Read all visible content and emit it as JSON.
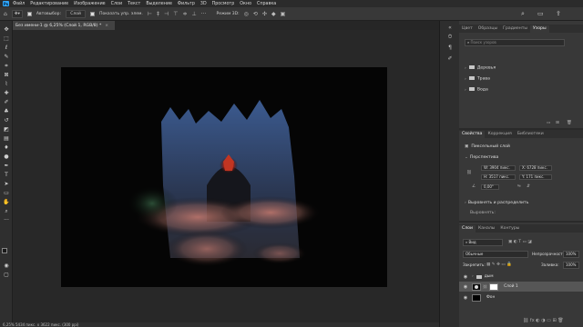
{
  "menubar": {
    "items": [
      "Файл",
      "Редактирование",
      "Изображение",
      "Слои",
      "Текст",
      "Выделение",
      "Фильтр",
      "3D",
      "Просмотр",
      "Окно",
      "Справка"
    ]
  },
  "options": {
    "autoselect_label": "Автовыбор:",
    "autoselect_value": "Слой",
    "show_controls_label": "Показать упр. элем.",
    "mode_label": "Режим 3D:"
  },
  "document": {
    "tab_title": "Без имени-1 @ 6,25% (Слой 1, RGB/8) *",
    "close": "×"
  },
  "status": {
    "text": "6,25%    5434 пикс. x 3622 пикс. (300 ppi)"
  },
  "libraries": {
    "tabs": [
      "Цвет",
      "Образцы",
      "Градиенты",
      "Узоры"
    ],
    "active_tab": "Узоры",
    "search_placeholder": "Поиск узоров",
    "folders": [
      "Деревья",
      "Трава",
      "Вода"
    ]
  },
  "properties": {
    "tabs": [
      "Свойства",
      "Коррекция",
      "Библиотеки"
    ],
    "active_tab": "Свойства",
    "layer_type": "Пиксельный слой",
    "transform_title": "Перспектива",
    "w": "W: 3904 пикс.",
    "h": "H: 3517 пикс.",
    "x": "X: 6728 пикс.",
    "y": "Y: 171 пикс.",
    "angle": "0,00°",
    "align_title": "Выровнять и распределить",
    "align_sub": "Выровнять:"
  },
  "layers": {
    "tabs": [
      "Слои",
      "Каналы",
      "Контуры"
    ],
    "active_tab": "Слои",
    "filter_value": "Вид",
    "blend_mode": "Обычные",
    "opacity_label": "Непрозрачность:",
    "opacity_value": "100%",
    "lock_label": "Закрепить:",
    "fill_label": "Заливка:",
    "fill_value": "100%",
    "rows": [
      {
        "name": "дым",
        "type": "group"
      },
      {
        "name": "Слой 1",
        "type": "masked",
        "selected": true
      },
      {
        "name": "Фон",
        "type": "background"
      }
    ]
  },
  "colors": {
    "accent": "#31a8ff",
    "panel_bg": "#383838",
    "canvas_bg": "#050505"
  }
}
